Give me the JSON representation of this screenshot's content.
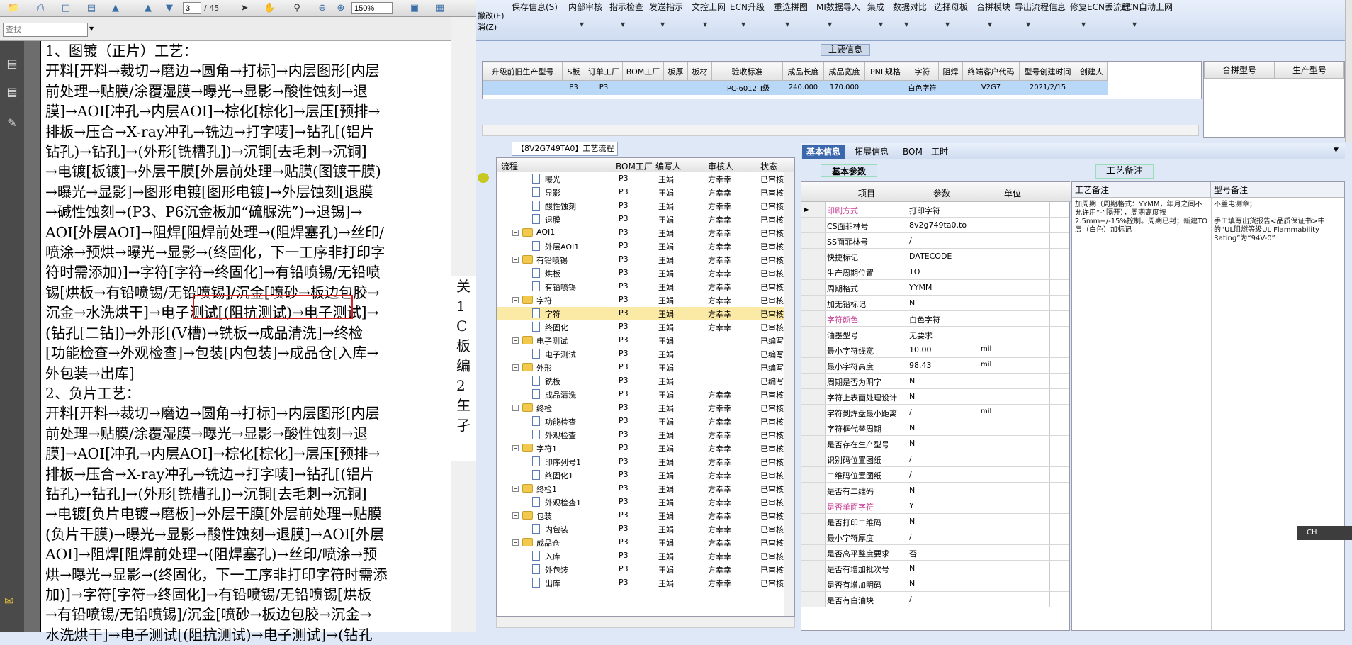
{
  "pdf": {
    "page_current": "3",
    "page_total": "/ 45",
    "zoom": "150%",
    "search_placeholder": "查找",
    "lines": [
      "1、图镀（正片）工艺：",
      "开料[开料→裁切→磨边→圆角→打标]→内层图形[内层",
      "前处理→贴膜/涂覆湿膜→曝光→显影→酸性蚀刻→退",
      "膜]→AOI[冲孔→内层AOI]→棕化[棕化]→层压[预排→",
      "排板→压合→X-ray冲孔→铣边→打字唛]→钻孔[(铝片",
      "钻孔)→钻孔]→(外形[铣槽孔])→沉铜[去毛刺→沉铜]",
      "→电镀[板镀]→外层干膜[外层前处理→贴膜(图镀干膜)",
      "→曝光→显影]→图形电镀[图形电镀]→外层蚀刻[退膜",
      "→碱性蚀刻→(P3、P6沉金板加“硫脲洗”)→退锡]→",
      "AOI[外层AOI]→阻焊[阻焊前处理→(阻焊塞孔)→丝印/",
      "喷涂→预烘→曝光→显影→(终固化，下一工序非打印字",
      "符时需添加)]→字符[字符→终固化]→有铅喷锡/无铅喷",
      "锡[烘板→有铅喷锡/无铅喷锡]/沉金[喷砂→板边包胶→",
      "沉金→水洗烘干]→电子测试[(阻抗测试)→电子测试]→",
      "(钻孔[二钻])→外形[(V槽)→铣板→成品清洗]→终检",
      "[功能检查→外观检查]→包装[内包装]→成品仓[入库→",
      "外包装→出库]",
      "2、负片工艺：",
      "开料[开料→裁切→磨边→圆角→打标]→内层图形[内层",
      "前处理→贴膜/涂覆湿膜→曝光→显影→酸性蚀刻→退",
      "膜]→AOI[冲孔→内层AOI]→棕化[棕化]→层压[预排→",
      "排板→压合→X-ray冲孔→铣边→打字唛]→钻孔[(铝片",
      "钻孔)→钻孔]→(外形[铣槽孔])→沉铜[去毛刺→沉铜]",
      "→电镀[负片电镀→磨板]→外层干膜[外层前处理→贴膜",
      "(负片干膜)→曝光→显影→酸性蚀刻→退膜]→AOI[外层",
      "AOI]→阻焊[阻焊前处理→(阻焊塞孔)→丝印/喷涂→预",
      "烘→曝光→显影→(终固化，下一工序非打印字符时需添",
      "加)]→字符[字符→终固化]→有铅喷锡/无铅喷锡[烘板",
      "→有铅喷锡/无铅喷锡]/沉金[喷砂→板边包胶→沉金→",
      "水洗烘干]→电子测试[(阻抗测试)→电子测试]→(钻孔"
    ],
    "cut_lines": [
      "关",
      "1",
      "C",
      "板",
      "编",
      "2",
      "玍",
      "孑"
    ]
  },
  "ribbon": {
    "left_line1": "撤改(E)",
    "left_line2": "消(Z)",
    "buttons": [
      "保存信息(S)",
      "内部审核",
      "指示检查",
      "发送指示",
      "文控上网",
      "ECN升级",
      "重选拼图",
      "MI数据导入",
      "集成",
      "数据对比",
      "选择母板",
      "合拼模块",
      "导出流程信息",
      "修复ECN丢流程",
      "ECN自动上网"
    ]
  },
  "main_info": {
    "title": "主要信息",
    "columns": [
      "升级前旧生产型号",
      "S板",
      "订单工厂",
      "BOM工厂",
      "板厚",
      "板材",
      "验收标准",
      "成品长度",
      "成品宽度",
      "PNL规格",
      "字符",
      "阻焊",
      "终端客户代码",
      "型号创建时间",
      "创建人"
    ],
    "row": [
      "",
      "P3",
      "P3",
      "",
      "",
      "",
      "IPC-6012 Ⅱ级",
      "240.000",
      "170.000",
      "",
      "白色字符",
      "",
      "V2G7",
      "2021/2/15",
      ""
    ],
    "merge_cols": [
      "合拼型号",
      "生产型号"
    ]
  },
  "process": {
    "tab_title": "【8V2G749TA0】工艺流程",
    "columns": [
      "流程",
      "BOM工厂",
      "编写人",
      "审核人",
      "状态"
    ],
    "rows": [
      {
        "level": 2,
        "kind": "doc",
        "name": "曝光",
        "bom": "P3",
        "writer": "王娟",
        "reviewer": "方幸幸",
        "status": "已审核"
      },
      {
        "level": 2,
        "kind": "doc",
        "name": "显影",
        "bom": "P3",
        "writer": "王娟",
        "reviewer": "方幸幸",
        "status": "已审核"
      },
      {
        "level": 2,
        "kind": "doc",
        "name": "酸性蚀刻",
        "bom": "P3",
        "writer": "王娟",
        "reviewer": "方幸幸",
        "status": "已审核"
      },
      {
        "level": 2,
        "kind": "doc",
        "name": "退膜",
        "bom": "P3",
        "writer": "王娟",
        "reviewer": "方幸幸",
        "status": "已审核"
      },
      {
        "level": 1,
        "kind": "folder",
        "name": "AOI1",
        "bom": "P3",
        "writer": "王娟",
        "reviewer": "方幸幸",
        "status": "已审核"
      },
      {
        "level": 2,
        "kind": "doc",
        "name": "外层AOI1",
        "bom": "P3",
        "writer": "王娟",
        "reviewer": "方幸幸",
        "status": "已审核"
      },
      {
        "level": 1,
        "kind": "folder",
        "name": "有铅喷锡",
        "bom": "P3",
        "writer": "王娟",
        "reviewer": "方幸幸",
        "status": "已审核"
      },
      {
        "level": 2,
        "kind": "doc",
        "name": "烘板",
        "bom": "P3",
        "writer": "王娟",
        "reviewer": "方幸幸",
        "status": "已审核"
      },
      {
        "level": 2,
        "kind": "doc",
        "name": "有铅喷锡",
        "bom": "P3",
        "writer": "王娟",
        "reviewer": "方幸幸",
        "status": "已审核"
      },
      {
        "level": 1,
        "kind": "folder",
        "name": "字符",
        "bom": "P3",
        "writer": "王娟",
        "reviewer": "方幸幸",
        "status": "已审核"
      },
      {
        "level": 2,
        "kind": "doc",
        "name": "字符",
        "bom": "P3",
        "writer": "王娟",
        "reviewer": "方幸幸",
        "status": "已审核",
        "selected": true
      },
      {
        "level": 2,
        "kind": "doc",
        "name": "终固化",
        "bom": "P3",
        "writer": "王娟",
        "reviewer": "方幸幸",
        "status": "已审核"
      },
      {
        "level": 1,
        "kind": "folder",
        "name": "电子测试",
        "bom": "P3",
        "writer": "王娟",
        "reviewer": "",
        "status": "已编写"
      },
      {
        "level": 2,
        "kind": "doc",
        "name": "电子测试",
        "bom": "P3",
        "writer": "王娟",
        "reviewer": "",
        "status": "已编写"
      },
      {
        "level": 1,
        "kind": "folder",
        "name": "外形",
        "bom": "P3",
        "writer": "王娟",
        "reviewer": "",
        "status": "已编写"
      },
      {
        "level": 2,
        "kind": "doc",
        "name": "铣板",
        "bom": "P3",
        "writer": "王娟",
        "reviewer": "",
        "status": "已编写"
      },
      {
        "level": 2,
        "kind": "doc",
        "name": "成品清洗",
        "bom": "P3",
        "writer": "王娟",
        "reviewer": "方幸幸",
        "status": "已审核"
      },
      {
        "level": 1,
        "kind": "folder",
        "name": "终检",
        "bom": "P3",
        "writer": "王娟",
        "reviewer": "方幸幸",
        "status": "已审核"
      },
      {
        "level": 2,
        "kind": "doc",
        "name": "功能检查",
        "bom": "P3",
        "writer": "王娟",
        "reviewer": "方幸幸",
        "status": "已审核"
      },
      {
        "level": 2,
        "kind": "doc",
        "name": "外观检查",
        "bom": "P3",
        "writer": "王娟",
        "reviewer": "方幸幸",
        "status": "已审核"
      },
      {
        "level": 1,
        "kind": "folder",
        "name": "字符1",
        "bom": "P3",
        "writer": "王娟",
        "reviewer": "方幸幸",
        "status": "已审核"
      },
      {
        "level": 2,
        "kind": "doc",
        "name": "印序列号1",
        "bom": "P3",
        "writer": "王娟",
        "reviewer": "方幸幸",
        "status": "已审核"
      },
      {
        "level": 2,
        "kind": "doc",
        "name": "终固化1",
        "bom": "P3",
        "writer": "王娟",
        "reviewer": "方幸幸",
        "status": "已审核"
      },
      {
        "level": 1,
        "kind": "folder",
        "name": "终检1",
        "bom": "P3",
        "writer": "王娟",
        "reviewer": "方幸幸",
        "status": "已审核"
      },
      {
        "level": 2,
        "kind": "doc",
        "name": "外观检查1",
        "bom": "P3",
        "writer": "王娟",
        "reviewer": "方幸幸",
        "status": "已审核"
      },
      {
        "level": 1,
        "kind": "folder",
        "name": "包装",
        "bom": "P3",
        "writer": "王娟",
        "reviewer": "方幸幸",
        "status": "已审核"
      },
      {
        "level": 2,
        "kind": "doc",
        "name": "内包装",
        "bom": "P3",
        "writer": "王娟",
        "reviewer": "方幸幸",
        "status": "已审核"
      },
      {
        "level": 1,
        "kind": "folder",
        "name": "成品仓",
        "bom": "P3",
        "writer": "王娟",
        "reviewer": "方幸幸",
        "status": "已审核"
      },
      {
        "level": 2,
        "kind": "doc",
        "name": "入库",
        "bom": "P3",
        "writer": "王娟",
        "reviewer": "方幸幸",
        "status": "已审核"
      },
      {
        "level": 2,
        "kind": "doc",
        "name": "外包装",
        "bom": "P3",
        "writer": "王娟",
        "reviewer": "方幸幸",
        "status": "已审核"
      },
      {
        "level": 2,
        "kind": "doc",
        "name": "出库",
        "bom": "P3",
        "writer": "王娟",
        "reviewer": "方幸幸",
        "status": "已审核"
      }
    ]
  },
  "info_tabs": [
    "基本信息",
    "拓展信息",
    "BOM",
    "工时"
  ],
  "basic_params": {
    "title": "基本参数",
    "columns": [
      "项目",
      "参数",
      "单位"
    ],
    "rows": [
      {
        "k": "印刷方式",
        "v": "打印字符",
        "u": "",
        "pink": true,
        "arrow": true
      },
      {
        "k": "CS面菲林号",
        "v": "8v2g749ta0.to",
        "u": ""
      },
      {
        "k": "SS面菲林号",
        "v": "/",
        "u": ""
      },
      {
        "k": "快捷标记",
        "v": "DATECODE",
        "u": ""
      },
      {
        "k": "生产周期位置",
        "v": "TO",
        "u": ""
      },
      {
        "k": "周期格式",
        "v": "YYMM",
        "u": ""
      },
      {
        "k": "加无铅标记",
        "v": "N",
        "u": ""
      },
      {
        "k": "字符颜色",
        "v": "白色字符",
        "u": "",
        "pink": true
      },
      {
        "k": "油墨型号",
        "v": "无要求",
        "u": ""
      },
      {
        "k": "最小字符线宽",
        "v": "10.00",
        "u": "mil"
      },
      {
        "k": "最小字符高度",
        "v": "98.43",
        "u": "mil"
      },
      {
        "k": "周期是否为阴字",
        "v": "N",
        "u": ""
      },
      {
        "k": "字符上表面处理设计",
        "v": "N",
        "u": ""
      },
      {
        "k": "字符到焊盘最小距离",
        "v": "/",
        "u": "mil"
      },
      {
        "k": "字符框代替周期",
        "v": "N",
        "u": ""
      },
      {
        "k": "是否存在生产型号",
        "v": "N",
        "u": ""
      },
      {
        "k": "识别码位置图纸",
        "v": "/",
        "u": ""
      },
      {
        "k": "二维码位置图纸",
        "v": "/",
        "u": ""
      },
      {
        "k": "是否有二维码",
        "v": "N",
        "u": ""
      },
      {
        "k": "是否单面字符",
        "v": "Y",
        "u": "",
        "pink": true
      },
      {
        "k": "是否打印二维码",
        "v": "N",
        "u": ""
      },
      {
        "k": "最小字符厚度",
        "v": "/",
        "u": ""
      },
      {
        "k": "是否高平整度要求",
        "v": "否",
        "u": ""
      },
      {
        "k": "是否有增加批次号",
        "v": "N",
        "u": ""
      },
      {
        "k": "是否有增加明码",
        "v": "N",
        "u": ""
      },
      {
        "k": "是否有白油块",
        "v": "/",
        "u": ""
      }
    ]
  },
  "craft": {
    "title": "工艺备注",
    "col1": "工艺备注",
    "col2": "型号备注",
    "text1": "加周期（周期格式：YYMM，年月之间不允许用“-”隔开），周期高度按2.5mm+/-15%控制。周期已封；新建TO层（白色）加标记",
    "text2": "不盖电测章；\n\n手工填写出货报告<品质保证书>中的“UL阻燃等级UL Flammability Rating”为“94V-0”"
  },
  "ime": "CH"
}
